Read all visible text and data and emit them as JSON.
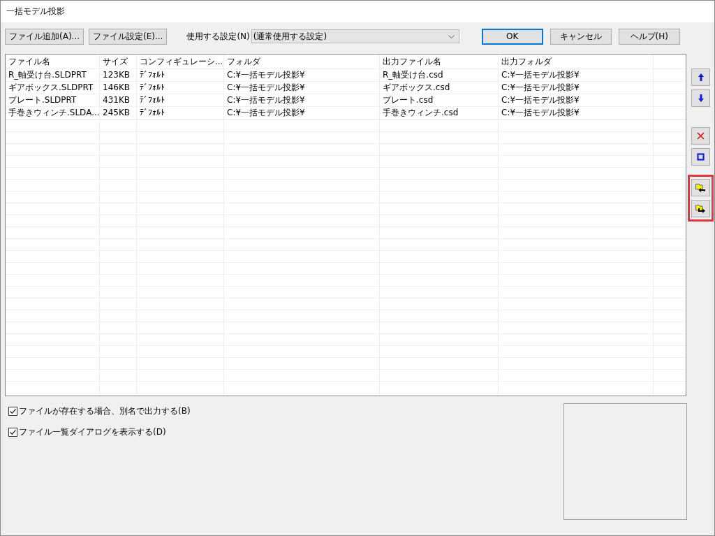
{
  "window": {
    "title": "一括モデル投影"
  },
  "toolbar": {
    "left_buttons": [
      "ファイル追加(A)...",
      "ファイル設定(E)..."
    ],
    "setting_label": "使用する設定(N)",
    "setting_value": "(通常使用する設定)",
    "right_buttons": [
      {
        "label": "OK",
        "default": true
      },
      {
        "label": "キャンセル",
        "default": false
      },
      {
        "label": "ヘルプ(H)",
        "default": false
      }
    ]
  },
  "table": {
    "columns": [
      "ファイル名",
      "サイズ",
      "コンフィギュレーシ...",
      "フォルダ",
      "出力ファイル名",
      "出力フォルダ"
    ],
    "rows": [
      [
        "R_軸受け台.SLDPRT",
        "123KB",
        "ﾃﾞﾌｫﾙﾄ",
        "C:¥一括モデル投影¥",
        "R_軸受け台.csd",
        "C:¥一括モデル投影¥"
      ],
      [
        "ギアボックス.SLDPRT",
        "146KB",
        "ﾃﾞﾌｫﾙﾄ",
        "C:¥一括モデル投影¥",
        "ギアボックス.csd",
        "C:¥一括モデル投影¥"
      ],
      [
        "プレート.SLDPRT",
        "431KB",
        "ﾃﾞﾌｫﾙﾄ",
        "C:¥一括モデル投影¥",
        "プレート.csd",
        "C:¥一括モデル投影¥"
      ],
      [
        "手巻きウィンチ.SLDA...",
        "245KB",
        "ﾃﾞﾌｫﾙﾄ",
        "C:¥一括モデル投影¥",
        "手巻きウィンチ.csd",
        "C:¥一括モデル投影¥"
      ]
    ]
  },
  "side_button_groups": [
    {
      "highlighted": false,
      "buttons": [
        {
          "kind": "up"
        },
        {
          "kind": "down"
        }
      ]
    },
    {
      "highlighted": false,
      "buttons": [
        {
          "kind": "delete"
        },
        {
          "kind": "square"
        }
      ]
    },
    {
      "highlighted": true,
      "buttons": [
        {
          "kind": "folder-in"
        },
        {
          "kind": "folder-out"
        }
      ]
    }
  ],
  "options": [
    {
      "label": "ファイルが存在する場合、別名で出力する(B)",
      "checked": true
    },
    {
      "label": "ファイル一覧ダイアログを表示する(D)",
      "checked": true
    }
  ]
}
